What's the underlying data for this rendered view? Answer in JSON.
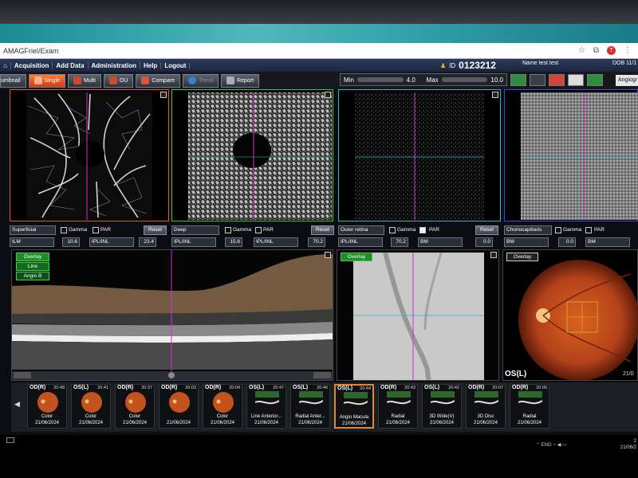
{
  "browser": {
    "url": "AMAGFriel/Exam"
  },
  "menu": [
    "Acquisition",
    "Add Data",
    "Administration",
    "Help",
    "Logout"
  ],
  "patient": {
    "id_label": "ID",
    "id": "0123212",
    "name_label": "Name",
    "name": "test test",
    "dob_label": "DOB",
    "dob": "11/1"
  },
  "toolbar": {
    "thumbnail": "umbnail",
    "single": "Single",
    "multi": "Multi",
    "ou": "OU",
    "compare": "Compare",
    "trend": "Trend",
    "report": "Report"
  },
  "range": {
    "min_label": "Min",
    "min_value": "4.0",
    "max_label": "Max",
    "max_value": "10.0"
  },
  "angio_label": "Angiogr",
  "panels": [
    {
      "layer": "Superficial",
      "from": "ILM",
      "from_val": "10.6",
      "to": "IPL/INL",
      "to_val": "23.4",
      "gamma": "Gamma",
      "par": "PAR",
      "reset": "Reset"
    },
    {
      "layer": "Deep",
      "from": "IPL/INL",
      "from_val": "15.6",
      "to": "IPL/INL",
      "to_val": "70.2",
      "gamma": "Gamma",
      "par": "PAR",
      "reset": "Reset"
    },
    {
      "layer": "Outer retina",
      "from": "IPL/INL",
      "from_val": "70.2",
      "to": "BM",
      "to_val": "0.0",
      "gamma": "Gamma",
      "par": "PAR",
      "reset": "Reset"
    },
    {
      "layer": "Choriocapillaris",
      "from": "BM",
      "from_val": "0.0",
      "to": "BM",
      "to_val": "",
      "gamma": "Gamma",
      "par": "PAR",
      "reset": ""
    }
  ],
  "bscan_overlay": [
    "Overlay",
    "Line",
    "Angio B"
  ],
  "enface_overlay": "Overlay",
  "fundus": {
    "overlay": "Overlay",
    "eye": "OS(L)",
    "date": "21/0"
  },
  "thumbnails": [
    {
      "eye": "OD(R)",
      "time": "20:48",
      "label": "Color",
      "date": "21/06/2024",
      "kind": "fundus"
    },
    {
      "eye": "OS(L)",
      "time": "20:41",
      "label": "Color",
      "date": "21/06/2024",
      "kind": "fundus"
    },
    {
      "eye": "OD(R)",
      "time": "20:37",
      "label": "Color",
      "date": "21/06/2024",
      "kind": "fundus"
    },
    {
      "eye": "OD(R)",
      "time": "20:03",
      "label": "",
      "date": "21/06/2024",
      "kind": "fundus"
    },
    {
      "eye": "OD(R)",
      "time": "20:04",
      "label": "Color",
      "date": "21/06/2024",
      "kind": "fundus"
    },
    {
      "eye": "OS(L)",
      "time": "20:47",
      "label": "Line Anterior...",
      "date": "21/06/2024",
      "kind": "scan"
    },
    {
      "eye": "OS(L)",
      "time": "20:46",
      "label": "Radial Anter...",
      "date": "21/06/2024",
      "kind": "scan"
    },
    {
      "eye": "OS(L)",
      "time": "20:44",
      "label": "Angio Macula",
      "date": "21/06/2024",
      "kind": "scan"
    },
    {
      "eye": "OD(R)",
      "time": "20:43",
      "label": "Radial",
      "date": "21/06/2024",
      "kind": "scan"
    },
    {
      "eye": "OS(L)",
      "time": "20:42",
      "label": "3D Wide(V)",
      "date": "21/06/2024",
      "kind": "scan"
    },
    {
      "eye": "OD(R)",
      "time": "20:07",
      "label": "3D Disc",
      "date": "21/06/2024",
      "kind": "scan"
    },
    {
      "eye": "OD(R)",
      "time": "20:05",
      "label": "Radial",
      "date": "21/06/2024",
      "kind": "scan"
    }
  ],
  "taskbar": {
    "lang": "ENG",
    "time": "2",
    "date": "21/06/2"
  },
  "colors": {
    "superficial": "#e2552a",
    "deep": "#39c93e",
    "outer": "#2bb6c2",
    "chorio": "#3a4fd6",
    "crosshair": "#d02fd0"
  }
}
